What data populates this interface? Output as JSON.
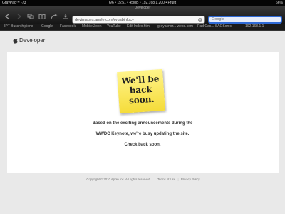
{
  "status": {
    "carrier": "GrayPad™ -73",
    "center": "6/6 • 15:51 • 45MB • 192.168.1.200 • Pruitt",
    "battery": "66%"
  },
  "toolbar": {
    "tab_title": "Developer",
    "url": "devimages.apple.com/rygabinlocv",
    "search_placeholder": "Google"
  },
  "bookmarks": [
    "IPT-Bussrchipione",
    "Google",
    "Facebook",
    "Mobile Zoon",
    "YouTube",
    "Edit Index.html",
    "grayasnor... webs.com",
    "iPad Cas... SAGSonic",
    "192.168.1.1"
  ],
  "brand": {
    "name": "Developer"
  },
  "note": {
    "line1": "We'll be",
    "line2": "back",
    "line3": "soon."
  },
  "message": {
    "line1": "Based on the exciting announcements during the",
    "line2": "WWDC Keynote, we're busy updating the site.",
    "line3": "Check back soon."
  },
  "footer": {
    "copyright": "Copyright © 2010 Apple Inc. All rights reserved.",
    "terms": "Terms of Use",
    "privacy": "Privacy Policy"
  }
}
